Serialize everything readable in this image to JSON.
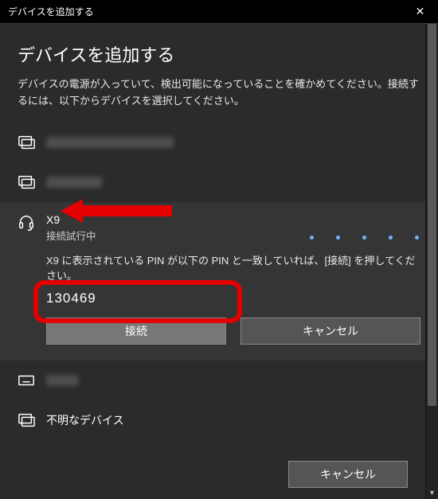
{
  "titlebar": {
    "title": "デバイスを追加する"
  },
  "heading": "デバイスを追加する",
  "instructions": "デバイスの電源が入っていて、検出可能になっていることを確かめてください。接続するには、以下からデバイスを選択してください。",
  "devices": {
    "item3": {
      "name": "X9",
      "status": "接続試行中",
      "message": "X9 に表示されている PIN が以下の PIN と一致していれば、[接続] を押してください。",
      "pin": "130469",
      "connect_label": "接続",
      "cancel_label": "キャンセル"
    },
    "item5": {
      "name": "不明なデバイス"
    }
  },
  "footer": {
    "cancel_label": "キャンセル"
  },
  "icons": {
    "monitor": "monitor-icon",
    "headset": "headset-icon",
    "keyboard": "keyboard-icon",
    "display": "display-icon"
  },
  "colors": {
    "highlight": "#e40000",
    "accent_dot": "#6fb2ff"
  }
}
